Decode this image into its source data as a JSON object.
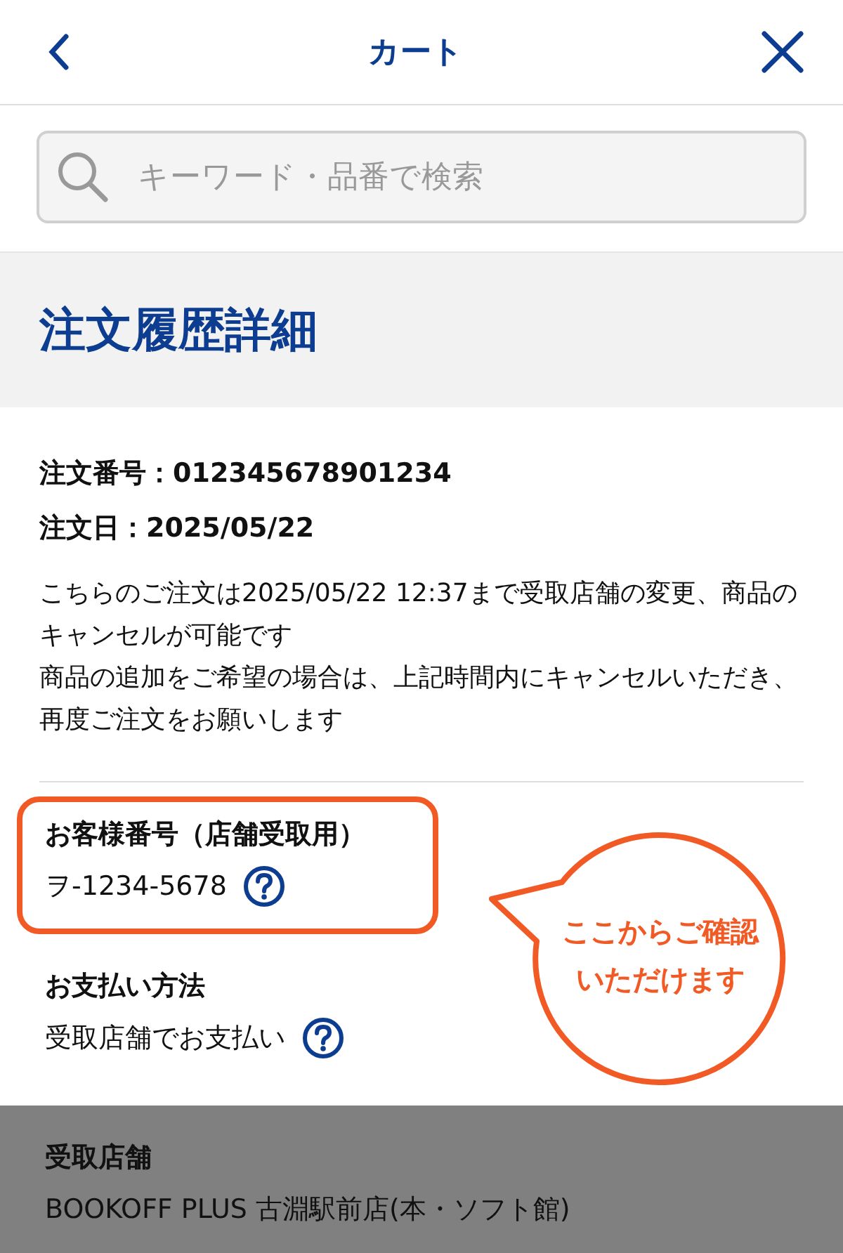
{
  "header": {
    "title": "カート"
  },
  "search": {
    "placeholder": "キーワード・品番で検索"
  },
  "page_title": "注文履歴詳細",
  "order": [
    {
      "label": "注文番号：",
      "value": "012345678901234"
    },
    {
      "label": "注文日：",
      "value": "2025/05/22"
    }
  ],
  "notice": [
    "こちらのご注文は2025/05/22 12:37まで受取店舗の変更、商品のキャンセルが可能です",
    "商品の追加をご希望の場合は、上記時間内にキャンセルいただき、再度ご注文をお願いします"
  ],
  "sections": [
    {
      "label": "お客様番号（店舗受取用）",
      "value": "ヲ-1234-5678",
      "help": true,
      "highlighted": true,
      "dimmed": false
    },
    {
      "label": "お支払い方法",
      "value": "受取店舗でお支払い",
      "help": true,
      "highlighted": false,
      "dimmed": false
    },
    {
      "label": "受取店舗",
      "value": "BOOKOFF PLUS 古淵駅前店(本・ソフト館)",
      "help": false,
      "highlighted": false,
      "dimmed": true
    }
  ],
  "callout": {
    "lines": [
      "ここからご確認",
      "いただけます"
    ]
  }
}
